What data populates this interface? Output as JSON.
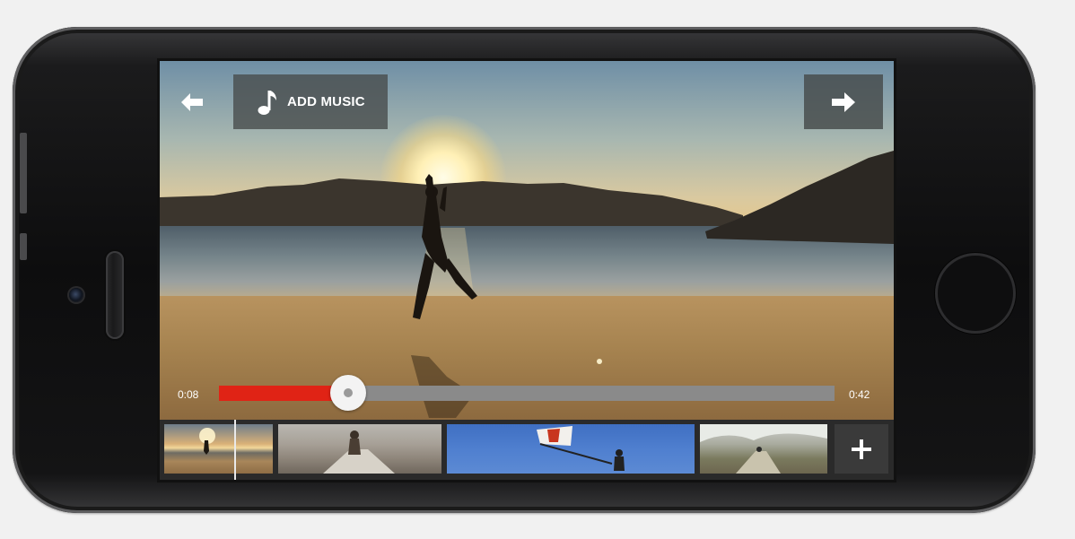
{
  "editor": {
    "add_music_label": "ADD MUSIC",
    "icons": {
      "back": "back-arrow-icon",
      "music": "music-note-icon",
      "next": "forward-arrow-icon",
      "add_clip": "plus-icon"
    }
  },
  "playback": {
    "current_time": "0:08",
    "total_time": "0:42",
    "progress_fraction": 0.21,
    "colors": {
      "played": "#e02315",
      "remaining": "#8a8a8a"
    }
  },
  "timeline": {
    "clips": [
      {
        "name": "beach-sunset-clip"
      },
      {
        "name": "boardwalk-clip"
      },
      {
        "name": "flag-kite-clip"
      },
      {
        "name": "forest-trail-clip"
      }
    ]
  }
}
